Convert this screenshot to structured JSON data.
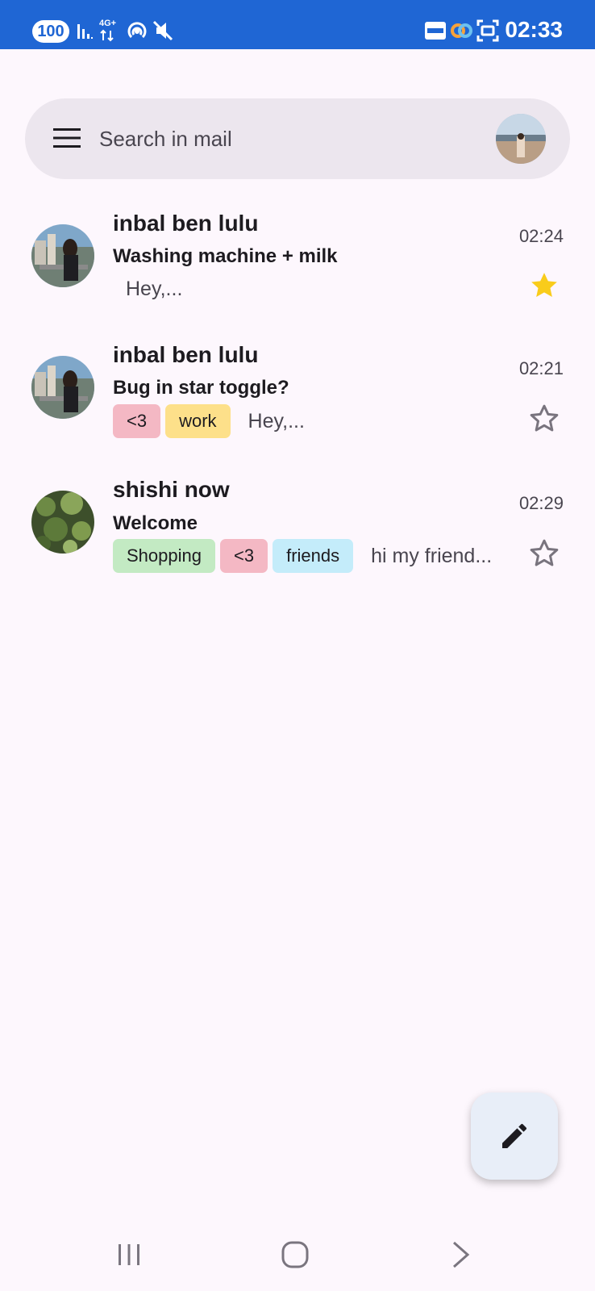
{
  "status_bar": {
    "battery": "100",
    "network": "4G+",
    "time": "02:33"
  },
  "search": {
    "placeholder": "Search in mail"
  },
  "emails": [
    {
      "sender": "inbal ben lulu",
      "subject": "Washing machine + milk",
      "time": "02:24",
      "preview": "Hey,...",
      "labels": [],
      "starred": true
    },
    {
      "sender": "inbal ben lulu",
      "subject": "Bug in star toggle?",
      "time": "02:21",
      "preview": "Hey,...",
      "labels": [
        "<3",
        "work"
      ],
      "starred": false
    },
    {
      "sender": "shishi now",
      "subject": "Welcome",
      "time": "02:29",
      "preview": "hi my friend...",
      "labels": [
        "Shopping",
        "<3",
        "friends"
      ],
      "starred": false
    }
  ],
  "label_colors": {
    "<3": "#f4b8c4",
    "work": "#fde08a",
    "Shopping": "#c3eac3",
    "friends": "#c4ecfa"
  },
  "colors": {
    "status_bar": "#1f66d4",
    "star_filled": "#f9cc1b",
    "star_outline": "#79747e"
  },
  "icons": {
    "menu": "hamburger-icon",
    "compose": "pencil-icon",
    "star": "star-icon"
  }
}
